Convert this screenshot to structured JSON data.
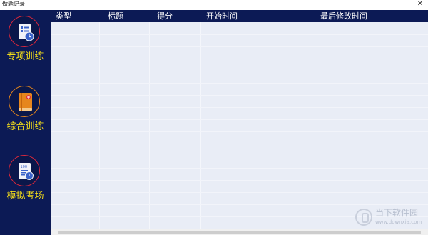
{
  "window": {
    "title": "做题记录",
    "close_glyph": "✕"
  },
  "sidebar": {
    "items": [
      {
        "label": "专项训练",
        "icon": "checklist-clock-icon",
        "ring_color": "#e0283c"
      },
      {
        "label": "综合训练",
        "icon": "book-icon",
        "ring_color": "#e6861d"
      },
      {
        "label": "模拟考场",
        "icon": "exam-paper-icon",
        "ring_color": "#e0283c"
      }
    ]
  },
  "table": {
    "columns": [
      "类型",
      "标题",
      "得分",
      "开始时间",
      "最后修改时间"
    ],
    "rows": []
  },
  "watermark": {
    "name": "当下软件园",
    "url": "www.downxia.com"
  },
  "colors": {
    "sidebar_bg": "#0c1a55",
    "header_bg": "#0c1a55",
    "label_color": "#f2dc1b",
    "table_bg": "#e9edf6"
  }
}
